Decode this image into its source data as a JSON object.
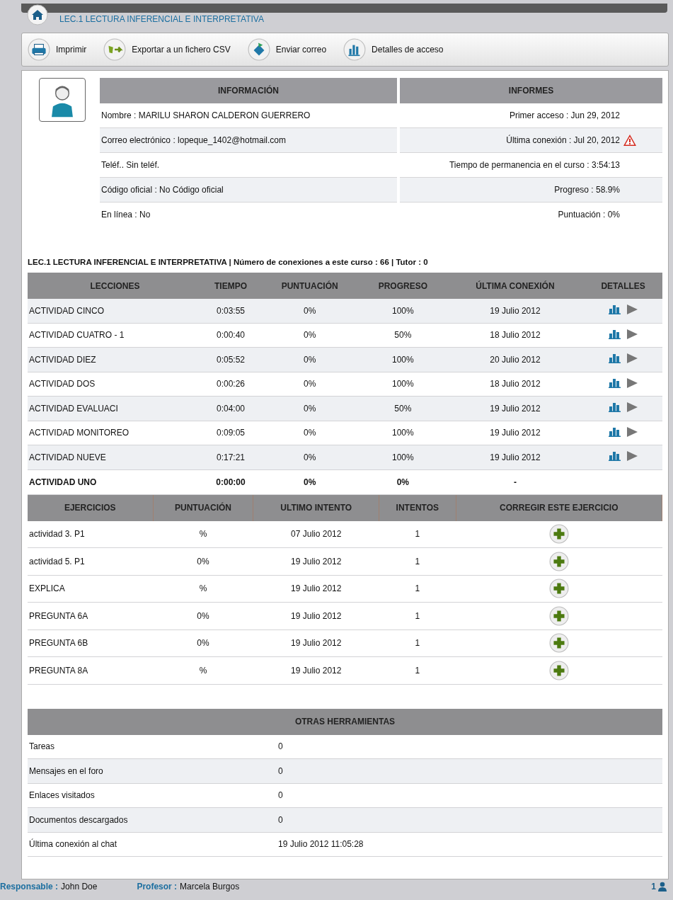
{
  "breadcrumb": {
    "title": "LEC.1 LECTURA INFERENCIAL E INTERPRETATIVA"
  },
  "toolbar": [
    {
      "label": "Imprimir",
      "kind": "print"
    },
    {
      "label": "Exportar a un fichero CSV",
      "kind": "export"
    },
    {
      "label": "Enviar correo",
      "kind": "mail"
    },
    {
      "label": "Detalles de acceso",
      "kind": "stats"
    }
  ],
  "info": {
    "headers": [
      "INFORMACIÓN",
      "INFORMES"
    ],
    "rows": [
      {
        "left": "Nombre : MARILU SHARON CALDERON GUERRERO",
        "right": "Primer acceso : Jun 29, 2012",
        "warning": false
      },
      {
        "left": "Correo electrónico : lopeque_1402@hotmail.com",
        "right": "Última conexión : Jul 20, 2012",
        "warning": true
      },
      {
        "left": "Teléf.. Sin teléf.",
        "right": "Tiempo de permanencia en el curso : 3:54:13",
        "warning": false
      },
      {
        "left": "Código oficial : No Código oficial",
        "right": "Progreso :  58.9%",
        "warning": false
      },
      {
        "left": "En línea : No",
        "right": "Puntuación :  0%",
        "warning": false
      }
    ]
  },
  "summary": "LEC.1 LECTURA INFERENCIAL E INTERPRETATIVA | Número de conexiones a este curso : 66  |  Tutor : 0",
  "lessons": {
    "columns": [
      "LECCIONES",
      "TIEMPO",
      "PUNTUACIÓN",
      "PROGRESO",
      "ÚLTIMA CONEXIÓN",
      "DETALLES"
    ],
    "rows": [
      {
        "cells": [
          "ACTIVIDAD CINCO",
          "0:03:55",
          "0%",
          "100%",
          "19 Julio 2012"
        ],
        "details": true
      },
      {
        "cells": [
          "ACTIVIDAD CUATRO - 1",
          "0:00:40",
          "0%",
          "50%",
          "18 Julio 2012"
        ],
        "details": true
      },
      {
        "cells": [
          "ACTIVIDAD DIEZ",
          "0:05:52",
          "0%",
          "100%",
          "20 Julio 2012"
        ],
        "details": true
      },
      {
        "cells": [
          "ACTIVIDAD DOS",
          "0:00:26",
          "0%",
          "100%",
          "18 Julio 2012"
        ],
        "details": true
      },
      {
        "cells": [
          "ACTIVIDAD EVALUACI",
          "0:04:00",
          "0%",
          "50%",
          "19 Julio 2012"
        ],
        "details": true
      },
      {
        "cells": [
          "ACTIVIDAD MONITOREO",
          "0:09:05",
          "0%",
          "100%",
          "19 Julio 2012"
        ],
        "details": true
      },
      {
        "cells": [
          "ACTIVIDAD NUEVE",
          "0:17:21",
          "0%",
          "100%",
          "19 Julio 2012"
        ],
        "details": true
      },
      {
        "cells": [
          "ACTIVIDAD UNO",
          "0:00:00",
          "0%",
          "0%",
          "-"
        ],
        "details": false
      }
    ]
  },
  "exercises": {
    "columns": [
      "EJERCICIOS",
      "PUNTUACIÓN",
      "ULTIMO INTENTO",
      "INTENTOS",
      "CORREGIR ESTE EJERCICIO"
    ],
    "rows": [
      {
        "cells": [
          "actividad 3. P1",
          "%",
          "07 Julio 2012",
          "1"
        ]
      },
      {
        "cells": [
          "actividad 5. P1",
          "0%",
          "19 Julio 2012",
          "1"
        ]
      },
      {
        "cells": [
          "EXPLICA",
          "%",
          "19 Julio 2012",
          "1"
        ]
      },
      {
        "cells": [
          "PREGUNTA 6A",
          "0%",
          "19 Julio 2012",
          "1"
        ]
      },
      {
        "cells": [
          "PREGUNTA 6B",
          "0%",
          "19 Julio 2012",
          "1"
        ]
      },
      {
        "cells": [
          "PREGUNTA 8A",
          "%",
          "19 Julio 2012",
          "1"
        ]
      }
    ]
  },
  "tools": {
    "title": "OTRAS HERRAMIENTAS",
    "rows": [
      {
        "label": "Tareas",
        "value": "0"
      },
      {
        "label": "Mensajes en el foro",
        "value": "0"
      },
      {
        "label": "Enlaces visitados",
        "value": "0"
      },
      {
        "label": "Documentos descargados",
        "value": "0"
      },
      {
        "label": "Última conexión al chat",
        "value": "19 Julio 2012 11:05:28"
      }
    ]
  },
  "footer": {
    "responsable_label": "Responsable :",
    "responsable": "John Doe",
    "profesor_label": "Profesor :",
    "profesor": "Marcela Burgos",
    "online_count": "1"
  }
}
